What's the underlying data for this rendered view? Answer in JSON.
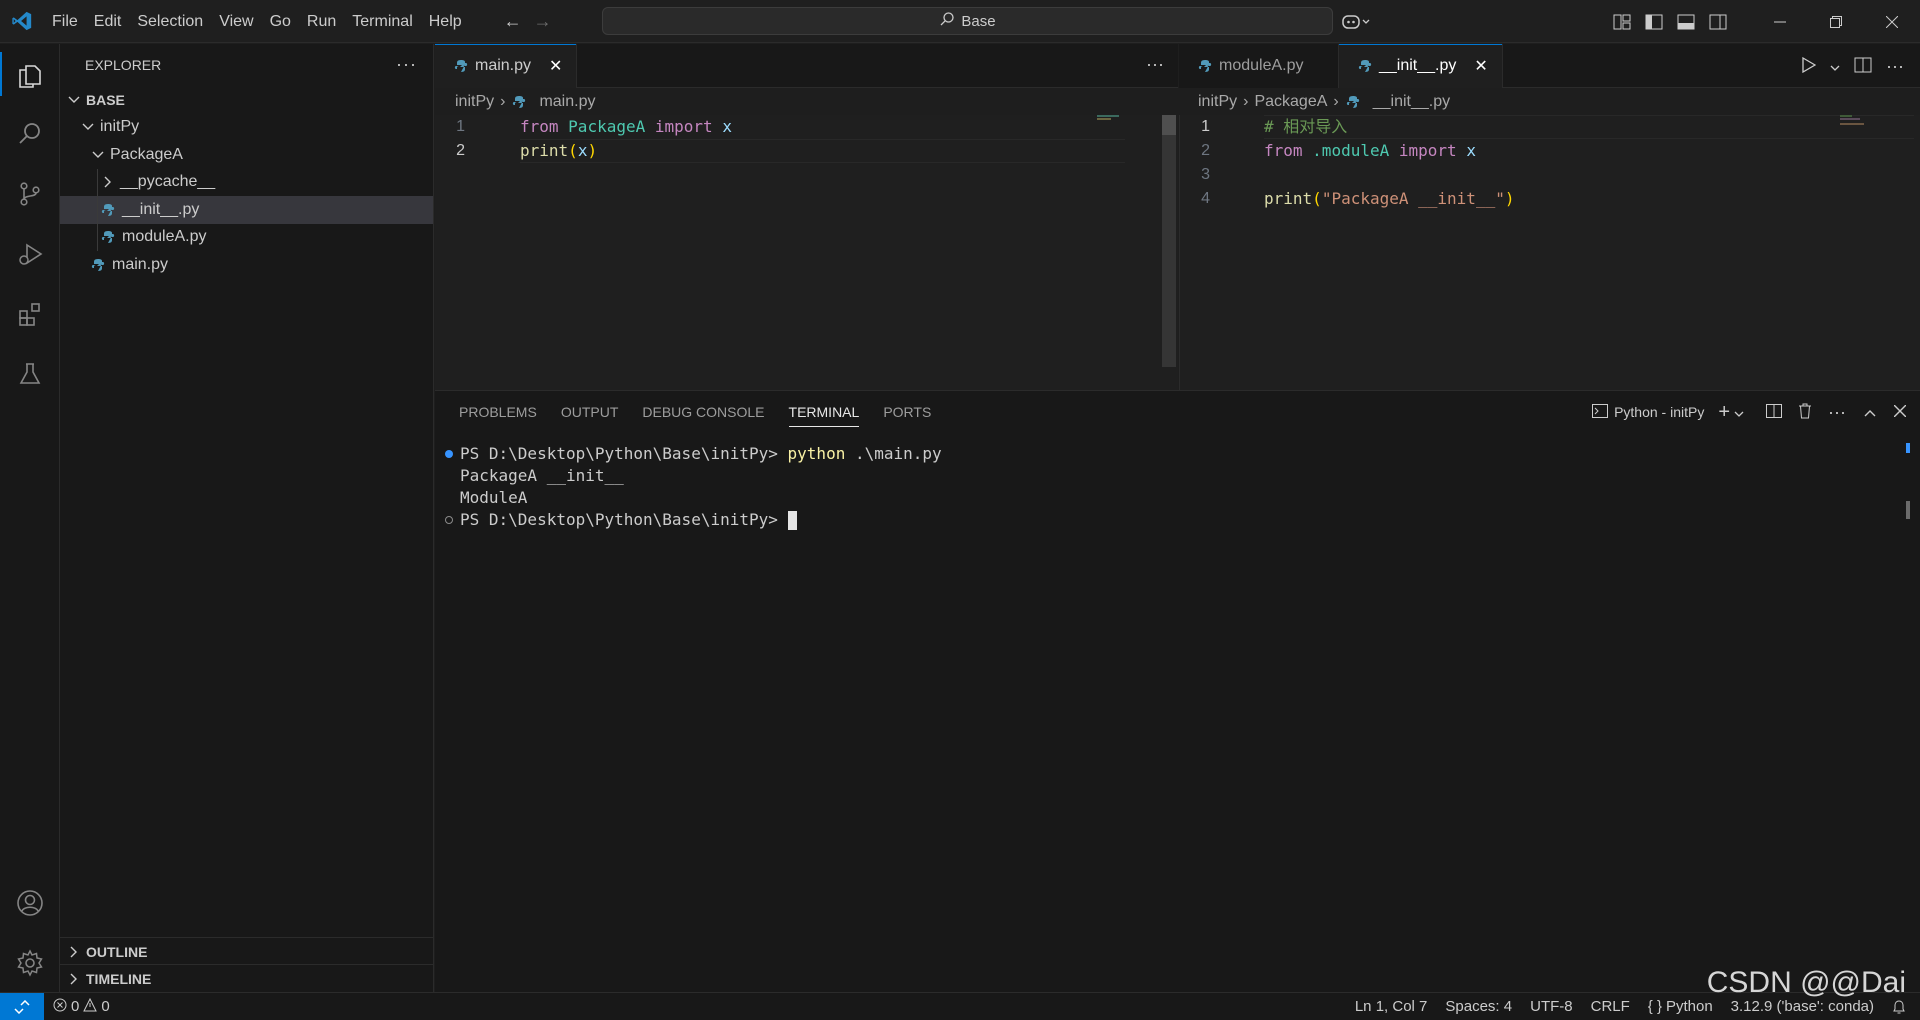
{
  "menu": [
    "File",
    "Edit",
    "Selection",
    "View",
    "Go",
    "Run",
    "Terminal",
    "Help"
  ],
  "search": {
    "label": "Base"
  },
  "sidebar": {
    "title": "EXPLORER",
    "root": "BASE",
    "tree": [
      {
        "label": "initPy",
        "kind": "folder-open"
      },
      {
        "label": "PackageA",
        "kind": "folder-open"
      },
      {
        "label": "__pycache__",
        "kind": "folder-closed"
      },
      {
        "label": "__init__.py",
        "kind": "python-file"
      },
      {
        "label": "moduleA.py",
        "kind": "python-file"
      },
      {
        "label": "main.py",
        "kind": "python-file"
      }
    ],
    "outline": "OUTLINE",
    "timeline": "TIMELINE"
  },
  "editor_left": {
    "tab": "main.py",
    "breadcrumb": [
      "initPy",
      "main.py"
    ],
    "lines": [
      "1",
      "2"
    ]
  },
  "editor_right": {
    "tabs": [
      "moduleA.py",
      "__init__.py"
    ],
    "breadcrumb": [
      "initPy",
      "PackageA",
      "__init__.py"
    ],
    "lines": [
      "1",
      "2",
      "3",
      "4"
    ]
  },
  "code_left": {
    "l1": {
      "kw1": "from",
      "mod": "PackageA",
      "kw2": "import",
      "name": "x"
    },
    "l2": {
      "fn": "print",
      "open": "(",
      "arg": "x",
      "close": ")"
    }
  },
  "code_right": {
    "l1": {
      "comment": "# 相对导入"
    },
    "l2": {
      "kw1": "from",
      "mod": ".moduleA",
      "kw2": "import",
      "name": "x"
    },
    "l4": {
      "fn": "print",
      "open": "(",
      "str": "\"PackageA __init__\"",
      "close": ")"
    }
  },
  "panel": {
    "tabs": [
      "PROBLEMS",
      "OUTPUT",
      "DEBUG CONSOLE",
      "TERMINAL",
      "PORTS"
    ],
    "terminal_name": "Python - initPy",
    "terminal": {
      "prompt1": "PS D:\\Desktop\\Python\\Base\\initPy>",
      "cmd1": "python",
      "args1": ".\\main.py",
      "out1": "PackageA __init__",
      "out2": "ModuleA",
      "prompt2": "PS D:\\Desktop\\Python\\Base\\initPy>"
    }
  },
  "statusbar": {
    "errors": "0",
    "warnings": "0",
    "position": "Ln 1, Col 7",
    "spaces": "Spaces: 4",
    "encoding": "UTF-8",
    "eol": "CRLF",
    "language": "Python",
    "interpreter": "3.12.9 ('base': conda)"
  },
  "watermark": "CSDN @@Dai",
  "colors": {
    "accent": "#0078d4",
    "python_icon": "#519aba"
  }
}
